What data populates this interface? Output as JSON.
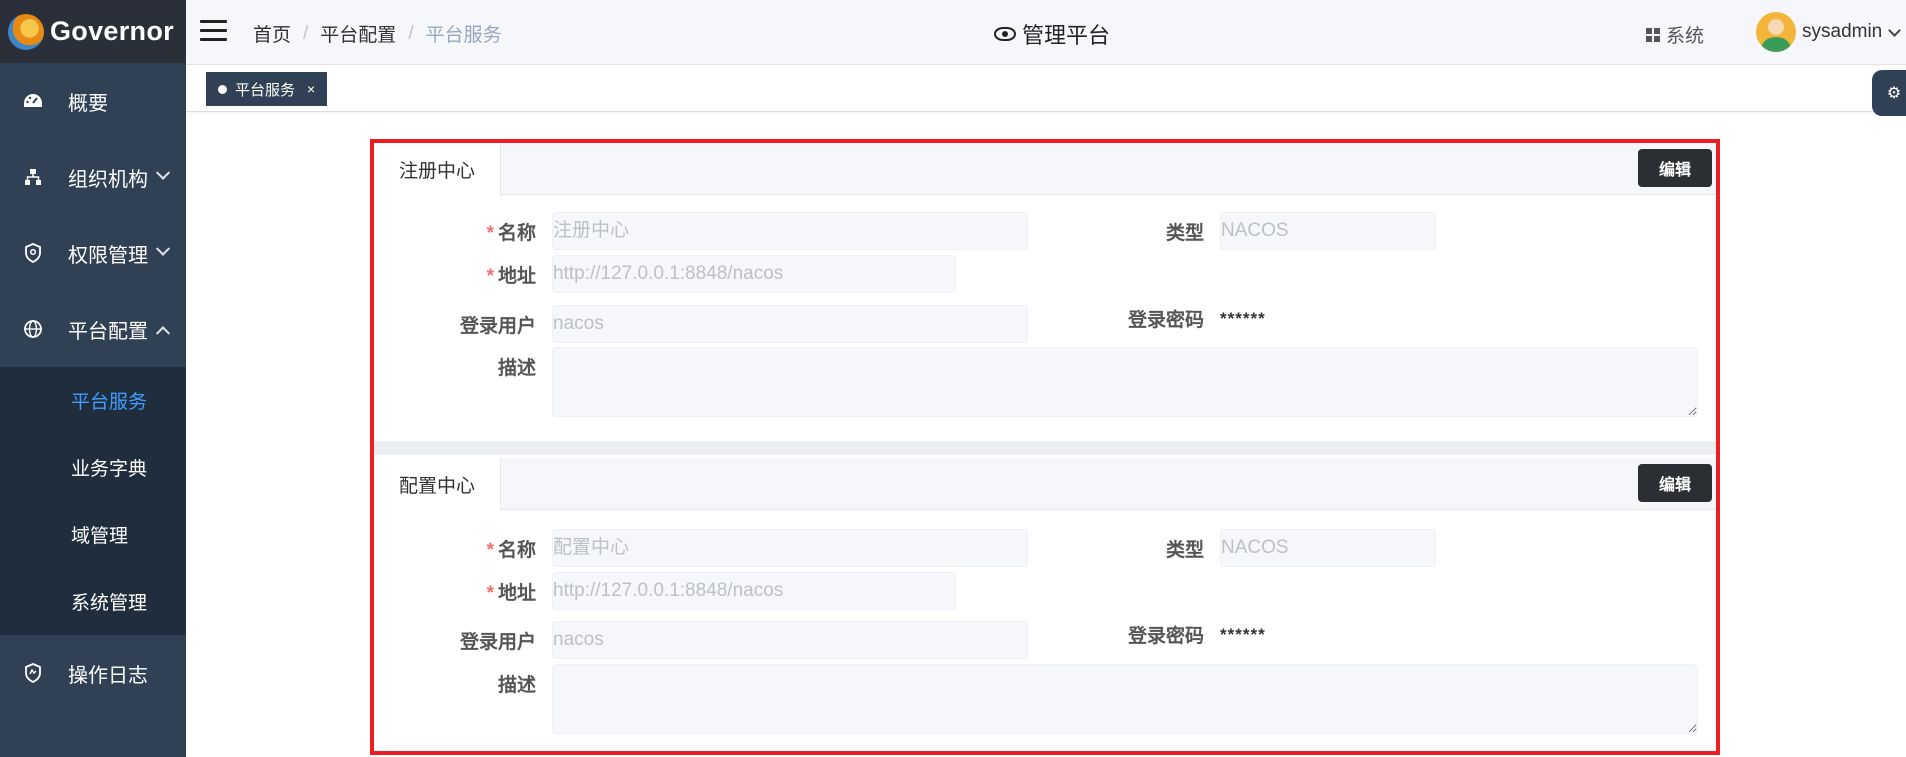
{
  "app": {
    "logo_text": "Governor",
    "title": "管理平台"
  },
  "sidebar": {
    "items": [
      {
        "label": "概要",
        "icon": "dashboard-icon"
      },
      {
        "label": "组织机构",
        "icon": "org-tree-icon"
      },
      {
        "label": "权限管理",
        "icon": "shield-icon"
      },
      {
        "label": "平台配置",
        "icon": "globe-icon"
      }
    ],
    "sub_items": [
      {
        "label": "平台服务",
        "active": true
      },
      {
        "label": "业务字典"
      },
      {
        "label": "域管理"
      },
      {
        "label": "系统管理"
      }
    ],
    "log_item": {
      "label": "操作日志",
      "icon": "log-shield-icon"
    }
  },
  "breadcrumb": {
    "home": "首页",
    "parent": "平台配置",
    "current": "平台服务",
    "sep": "/"
  },
  "header": {
    "system_label": "系统",
    "username": "sysadmin"
  },
  "tags": {
    "active": "平台服务",
    "close": "×"
  },
  "sections": [
    {
      "title": "注册中心",
      "edit_label": "编辑",
      "fields": {
        "name_label": "名称",
        "name_placeholder": "注册中心",
        "type_label": "类型",
        "type_placeholder": "NACOS",
        "addr_label": "地址",
        "addr_placeholder": "http://127.0.0.1:8848/nacos",
        "user_label": "登录用户",
        "user_placeholder": "nacos",
        "pwd_label": "登录密码",
        "pwd_value": "******",
        "desc_label": "描述"
      }
    },
    {
      "title": "配置中心",
      "edit_label": "编辑",
      "fields": {
        "name_label": "名称",
        "name_placeholder": "配置中心",
        "type_label": "类型",
        "type_placeholder": "NACOS",
        "addr_label": "地址",
        "addr_placeholder": "http://127.0.0.1:8848/nacos",
        "user_label": "登录用户",
        "user_placeholder": "nacos",
        "pwd_label": "登录密码",
        "pwd_value": "******",
        "desc_label": "描述"
      }
    }
  ],
  "required_mark": "*",
  "colors": {
    "sidebar": "#304156",
    "submenu": "#1f2d3d",
    "active": "#409eff",
    "highlight": "#ee1d23"
  }
}
